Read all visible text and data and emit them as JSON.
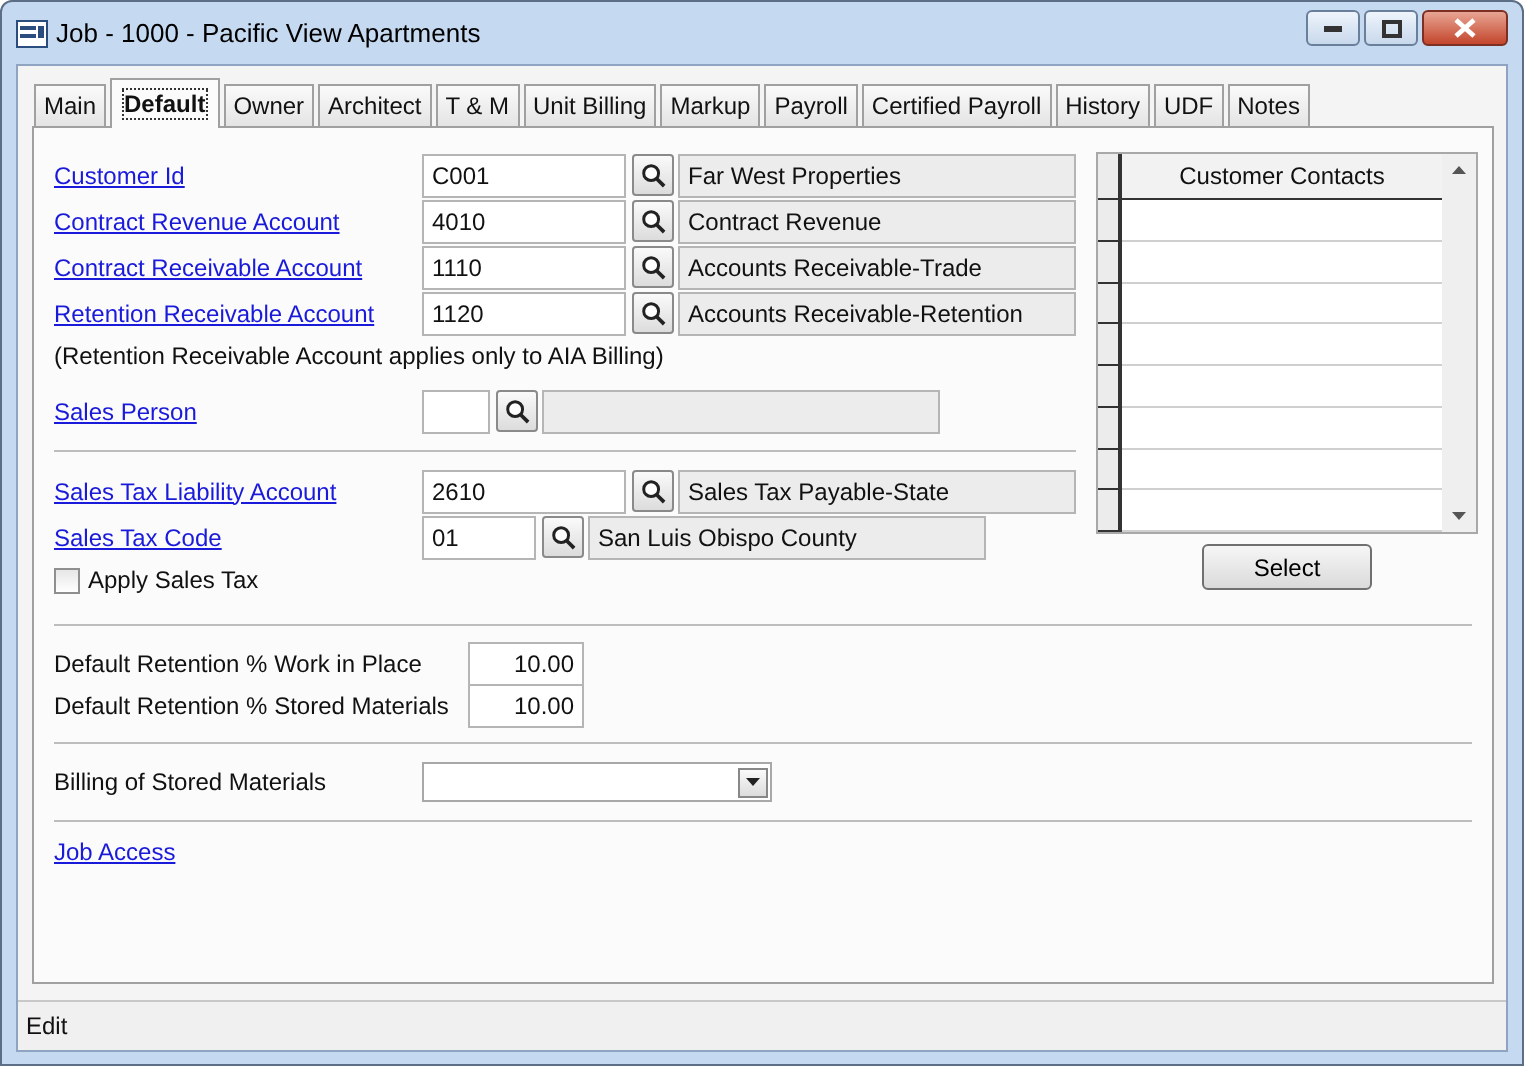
{
  "window": {
    "title": "Job - 1000 - Pacific View Apartments"
  },
  "tabs": [
    {
      "label": "Main",
      "selected": false
    },
    {
      "label": "Default",
      "selected": true
    },
    {
      "label": "Owner",
      "selected": false
    },
    {
      "label": "Architect",
      "selected": false
    },
    {
      "label": "T & M",
      "selected": false
    },
    {
      "label": "Unit Billing",
      "selected": false
    },
    {
      "label": "Markup",
      "selected": false
    },
    {
      "label": "Payroll",
      "selected": false
    },
    {
      "label": "Certified Payroll",
      "selected": false
    },
    {
      "label": "History",
      "selected": false
    },
    {
      "label": "UDF",
      "selected": false
    },
    {
      "label": "Notes",
      "selected": false
    }
  ],
  "accounts": [
    {
      "label": "Customer Id",
      "code": "C001",
      "description": "Far West Properties",
      "kind": "wide"
    },
    {
      "label": "Contract Revenue Account",
      "code": "4010",
      "description": "Contract Revenue",
      "kind": "wide"
    },
    {
      "label": "Contract Receivable Account",
      "code": "1110",
      "description": "Accounts Receivable-Trade",
      "kind": "wide"
    },
    {
      "label": "Retention Receivable Account",
      "code": "1120",
      "description": "Accounts Receivable-Retention",
      "kind": "wide"
    }
  ],
  "note": "(Retention Receivable Account applies only to AIA Billing)",
  "sales_person": {
    "label": "Sales Person",
    "kind": "narrow"
  },
  "tax_fields": [
    {
      "label": "Sales Tax Liability Account",
      "code": "2610",
      "description": "Sales Tax Payable-State",
      "kind": "wide"
    },
    {
      "label": "Sales Tax Code",
      "code": "01",
      "description": "San Luis Obispo County",
      "kind": "medium"
    }
  ],
  "apply_sales_tax": {
    "label": "Apply Sales Tax",
    "checked": false
  },
  "retention": [
    {
      "label": "Default Retention % Work in Place",
      "value": "10.00"
    },
    {
      "label": "Default Retention % Stored Materials",
      "value": "10.00"
    }
  ],
  "billing_stored": {
    "label": "Billing of Stored Materials"
  },
  "job_access": "Job Access",
  "contacts": {
    "header": "Customer Contacts"
  },
  "select_button": "Select",
  "status_bar": "Edit"
}
